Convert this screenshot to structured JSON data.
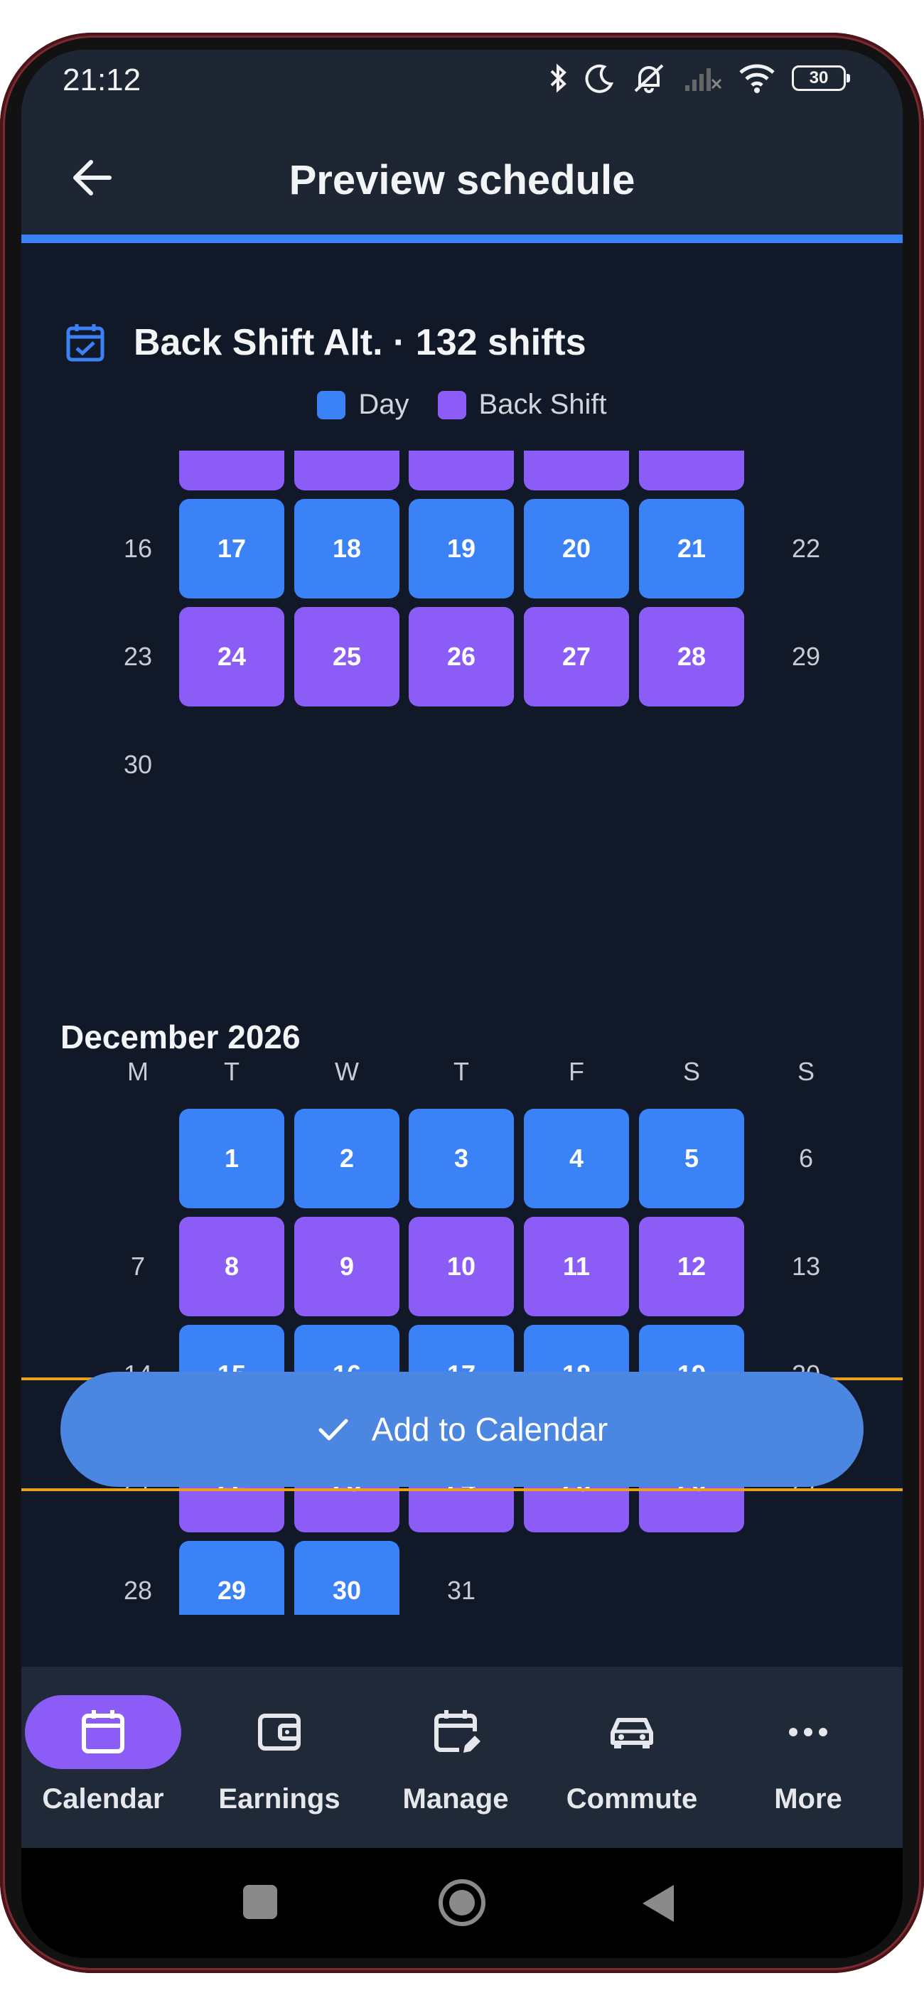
{
  "status_bar": {
    "time": "21:12",
    "battery": "30",
    "icons": [
      "bluetooth-icon",
      "do-not-disturb-moon-icon",
      "muted-bell-icon",
      "no-signal-icon",
      "wifi-icon",
      "battery-icon"
    ]
  },
  "app_bar": {
    "title": "Preview schedule",
    "back_icon": "arrow-left-icon"
  },
  "progress": {
    "value": 1.0,
    "color": "#3b82f6"
  },
  "schedule": {
    "title": "Back Shift Alt. · 132 shifts",
    "icon": "calendar-check-icon"
  },
  "legend": [
    {
      "label": "Day",
      "color": "#3b82f6"
    },
    {
      "label": "Back Shift",
      "color": "#8b5cf6"
    }
  ],
  "november_partial": {
    "rows": [
      [
        "",
        "back",
        "back",
        "back",
        "back",
        "back",
        ""
      ],
      [
        "16",
        "17",
        "18",
        "19",
        "20",
        "21",
        "22"
      ],
      [
        "23",
        "24",
        "25",
        "26",
        "27",
        "28",
        "29"
      ],
      [
        "30",
        "",
        "",
        "",
        "",
        "",
        ""
      ]
    ]
  },
  "december": {
    "title": "December 2026",
    "weekdays": [
      "M",
      "T",
      "W",
      "T",
      "F",
      "S",
      "S"
    ],
    "rows": [
      [
        "",
        "1",
        "2",
        "3",
        "4",
        "5",
        "6"
      ],
      [
        "7",
        "8",
        "9",
        "10",
        "11",
        "12",
        "13"
      ],
      [
        "14",
        "15",
        "16",
        "17",
        "18",
        "19",
        "20"
      ],
      [
        "21",
        "22",
        "23",
        "24",
        "25",
        "26",
        "27"
      ],
      [
        "28",
        "29",
        "30",
        "31",
        "",
        "",
        ""
      ]
    ]
  },
  "cta": {
    "label": "Add to Calendar",
    "icon": "check-icon"
  },
  "bottom_nav": [
    {
      "label": "Calendar",
      "icon": "calendar-icon",
      "active": true
    },
    {
      "label": "Earnings",
      "icon": "wallet-icon",
      "active": false
    },
    {
      "label": "Manage",
      "icon": "calendar-edit-icon",
      "active": false
    },
    {
      "label": "Commute",
      "icon": "car-icon",
      "active": false
    },
    {
      "label": "More",
      "icon": "more-horizontal-icon",
      "active": false
    }
  ],
  "system_nav": [
    "square-recent-icon",
    "circle-home-icon",
    "triangle-back-icon"
  ],
  "colors": {
    "day": "#3b82f6",
    "back_shift": "#8b5cf6",
    "cta": "#4b86e0",
    "background": "#111827"
  }
}
